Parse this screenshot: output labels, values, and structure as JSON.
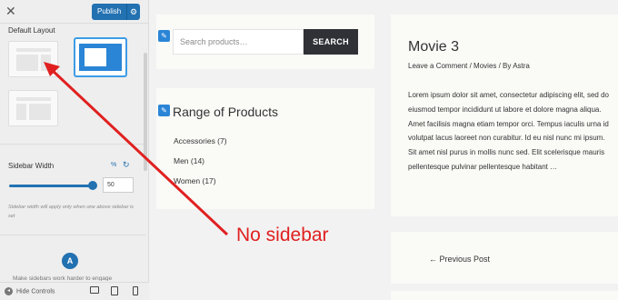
{
  "panel": {
    "publish_label": "Publish",
    "section_title": "Default Layout",
    "layout_options": [
      "default",
      "no-sidebar",
      "right-sidebar"
    ],
    "selected_layout": "no-sidebar",
    "sidebar_width_label": "Sidebar Width",
    "sidebar_width_unit": "%",
    "sidebar_width_value": "50",
    "sidebar_width_level": 0.9,
    "sidebar_width_note": "Sidebar width will apply only when one above sidebar is set",
    "cut_text": "Make sidebars work harder to engage",
    "hide_controls_label": "Hide Controls",
    "accent_color": "#2271b1"
  },
  "preview": {
    "search_placeholder": "Search products…",
    "search_button": "SEARCH",
    "widget_title": "Range of Products",
    "categories": [
      "Accessories (7)",
      "Men (14)",
      "Women (17)"
    ],
    "post": {
      "title": "Movie 3",
      "meta_comment": "Leave a Comment",
      "meta_sep1": " / ",
      "meta_category": "Movies",
      "meta_sep2": " / By ",
      "meta_author": "Astra",
      "excerpt": "Lorem ipsum dolor sit amet, consectetur adipiscing elit, sed do eiusmod tempor incididunt ut labore et dolore magna aliqua. Amet facilisis magna etiam tempor orci. Tempus iaculis urna id volutpat lacus laoreet non curabitur. Id eu nisl nunc mi ipsum. Sit amet nisl purus in mollis nunc sed. Elit scelerisque mauris pellentesque pulvinar pellentesque habitant …"
    },
    "prev_post": "← Previous Post"
  },
  "annotation": {
    "text": "No sidebar",
    "color": "#e02020"
  }
}
